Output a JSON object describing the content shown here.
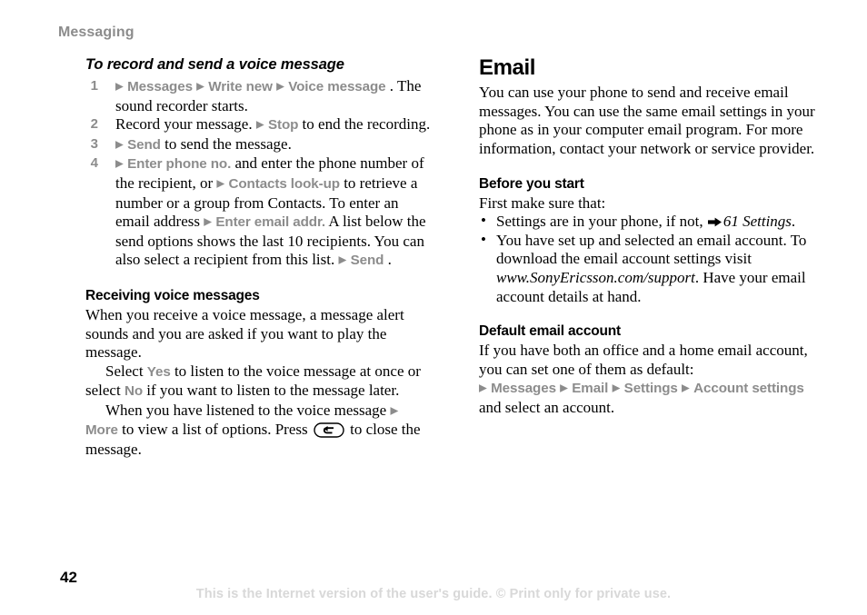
{
  "running_head": "Messaging",
  "page_number": "42",
  "footer_notice": "This is the Internet version of the user's guide. © Print only for private use.",
  "left_column": {
    "procedure_heading": "To record and send a voice message",
    "steps": [
      {
        "number": "1",
        "runs": [
          {
            "type": "arrow",
            "text": "▶"
          },
          {
            "type": "ui",
            "text": "Messages"
          },
          {
            "type": "arrow",
            "text": "▶"
          },
          {
            "type": "ui",
            "text": "Write new"
          },
          {
            "type": "arrow",
            "text": "▶"
          },
          {
            "type": "ui",
            "text": "Voice message"
          },
          {
            "type": "text",
            "text": ". The sound recorder starts."
          }
        ]
      },
      {
        "number": "2",
        "runs": [
          {
            "type": "text",
            "text": "Record your message. "
          },
          {
            "type": "arrow",
            "text": "▶"
          },
          {
            "type": "ui",
            "text": "Stop"
          },
          {
            "type": "text",
            "text": " to end the recording."
          }
        ]
      },
      {
        "number": "3",
        "runs": [
          {
            "type": "arrow",
            "text": "▶"
          },
          {
            "type": "ui",
            "text": "Send"
          },
          {
            "type": "text",
            "text": " to send the message."
          }
        ]
      },
      {
        "number": "4",
        "runs": [
          {
            "type": "arrow",
            "text": "▶"
          },
          {
            "type": "ui",
            "text": "Enter phone no."
          },
          {
            "type": "text",
            "text": " and enter the phone number of the recipient, or "
          },
          {
            "type": "arrow",
            "text": "▶"
          },
          {
            "type": "ui",
            "text": "Contacts look-up"
          },
          {
            "type": "text",
            "text": " to retrieve a number or a group from Contacts. To enter an email address "
          },
          {
            "type": "arrow",
            "text": "▶"
          },
          {
            "type": "ui",
            "text": "Enter email addr."
          },
          {
            "type": "text",
            "text": " A list below the send options shows the last 10 recipients. You can also select a recipient from this list. "
          },
          {
            "type": "arrow",
            "text": "▶"
          },
          {
            "type": "ui",
            "text": "Send"
          },
          {
            "type": "text",
            "text": "."
          }
        ]
      }
    ],
    "receiving_heading": "Receiving voice messages",
    "receiving_paragraph_1": "When you receive a voice message, a message alert sounds and you are asked if you want to play the message.",
    "receiving_paragraph_2": [
      {
        "type": "text",
        "text": "Select "
      },
      {
        "type": "ui",
        "text": "Yes"
      },
      {
        "type": "text",
        "text": " to listen to the voice message at once or select "
      },
      {
        "type": "ui",
        "text": "No"
      },
      {
        "type": "text",
        "text": " if you want to listen to the message later."
      }
    ],
    "receiving_paragraph_3": [
      {
        "type": "text",
        "text": "When you have listened to the voice message "
      },
      {
        "type": "arrow",
        "text": "▶"
      },
      {
        "type": "ui",
        "text": "More"
      },
      {
        "type": "text",
        "text": " to view a list of options. Press "
      },
      {
        "type": "keycap",
        "text": "back-key"
      },
      {
        "type": "text",
        "text": " to close the message."
      }
    ]
  },
  "right_column": {
    "section_title": "Email",
    "intro_paragraph": "You can use your phone to send and receive email messages. You can use the same email settings in your phone as in your computer email program. For more information, contact your network or service provider.",
    "before_heading": "Before you start",
    "before_intro": "First make sure that:",
    "before_bullets": [
      [
        {
          "type": "text",
          "text": "Settings are in your phone, if not, "
        },
        {
          "type": "xref",
          "text": "➡"
        },
        {
          "type": "italic",
          "text": "61 Settings"
        },
        {
          "type": "text",
          "text": "."
        }
      ],
      [
        {
          "type": "text",
          "text": "You have set up and selected an email account. To download the email account settings visit "
        },
        {
          "type": "italic",
          "text": "www.SonyEricsson.com/support"
        },
        {
          "type": "text",
          "text": ". Have your email account details at hand."
        }
      ]
    ],
    "default_heading": "Default email account",
    "default_paragraph_1": "If you have both an office and a home email account, you can set one of them as default:",
    "default_paragraph_2": [
      {
        "type": "arrow",
        "text": "▶"
      },
      {
        "type": "ui",
        "text": "Messages"
      },
      {
        "type": "arrow",
        "text": "▶"
      },
      {
        "type": "ui",
        "text": "Email"
      },
      {
        "type": "arrow",
        "text": "▶"
      },
      {
        "type": "ui",
        "text": "Settings"
      },
      {
        "type": "arrow",
        "text": "▶"
      },
      {
        "type": "ui",
        "text": "Account settings"
      }
    ],
    "default_paragraph_3": "and select an account."
  },
  "colors": {
    "ui_gray": "#8c8c8c",
    "watermark_gray": "#d8d8d8",
    "body_black": "#000000"
  }
}
